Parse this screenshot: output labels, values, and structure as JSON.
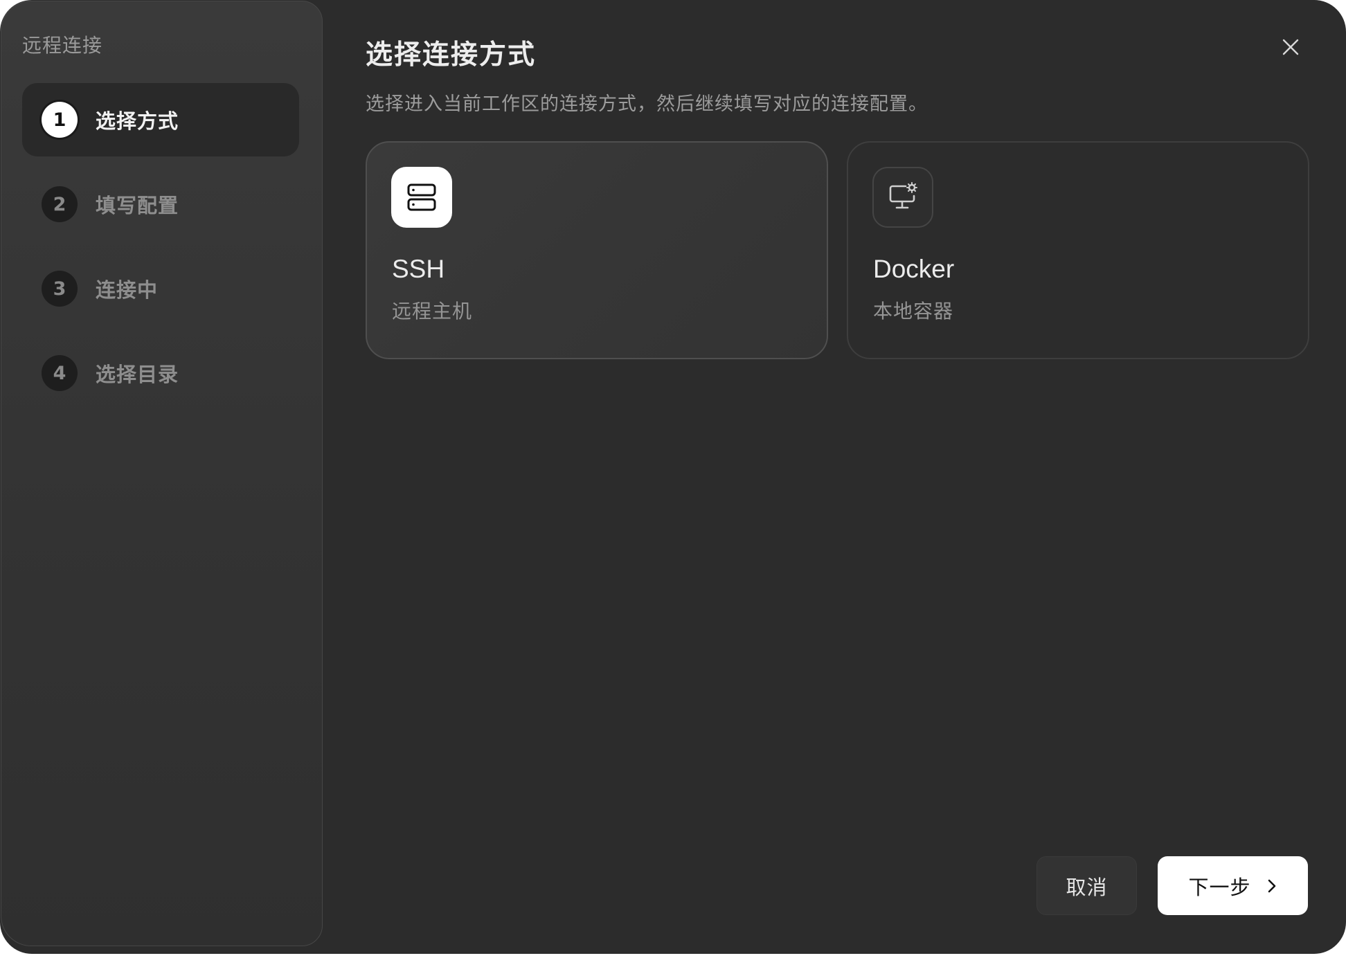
{
  "sidebar": {
    "title": "远程连接",
    "steps": [
      {
        "number": "1",
        "label": "选择方式",
        "active": true
      },
      {
        "number": "2",
        "label": "填写配置",
        "active": false
      },
      {
        "number": "3",
        "label": "连接中",
        "active": false
      },
      {
        "number": "4",
        "label": "选择目录",
        "active": false
      }
    ]
  },
  "main": {
    "title": "选择连接方式",
    "subtitle": "选择进入当前工作区的连接方式，然后继续填写对应的连接配置。",
    "close_icon": "close-icon",
    "options": [
      {
        "name": "SSH",
        "description": "远程主机",
        "icon": "server-icon",
        "selected": true
      },
      {
        "name": "Docker",
        "description": "本地容器",
        "icon": "monitor-gear-icon",
        "selected": false
      }
    ]
  },
  "footer": {
    "cancel_label": "取消",
    "next_label": "下一步",
    "next_icon": "chevron-right-icon"
  },
  "colors": {
    "background": "#2c2c2c",
    "sidebar": "#363636",
    "accent": "#ffffff",
    "text_primary": "#ededed",
    "text_secondary": "#9c9c9c"
  }
}
